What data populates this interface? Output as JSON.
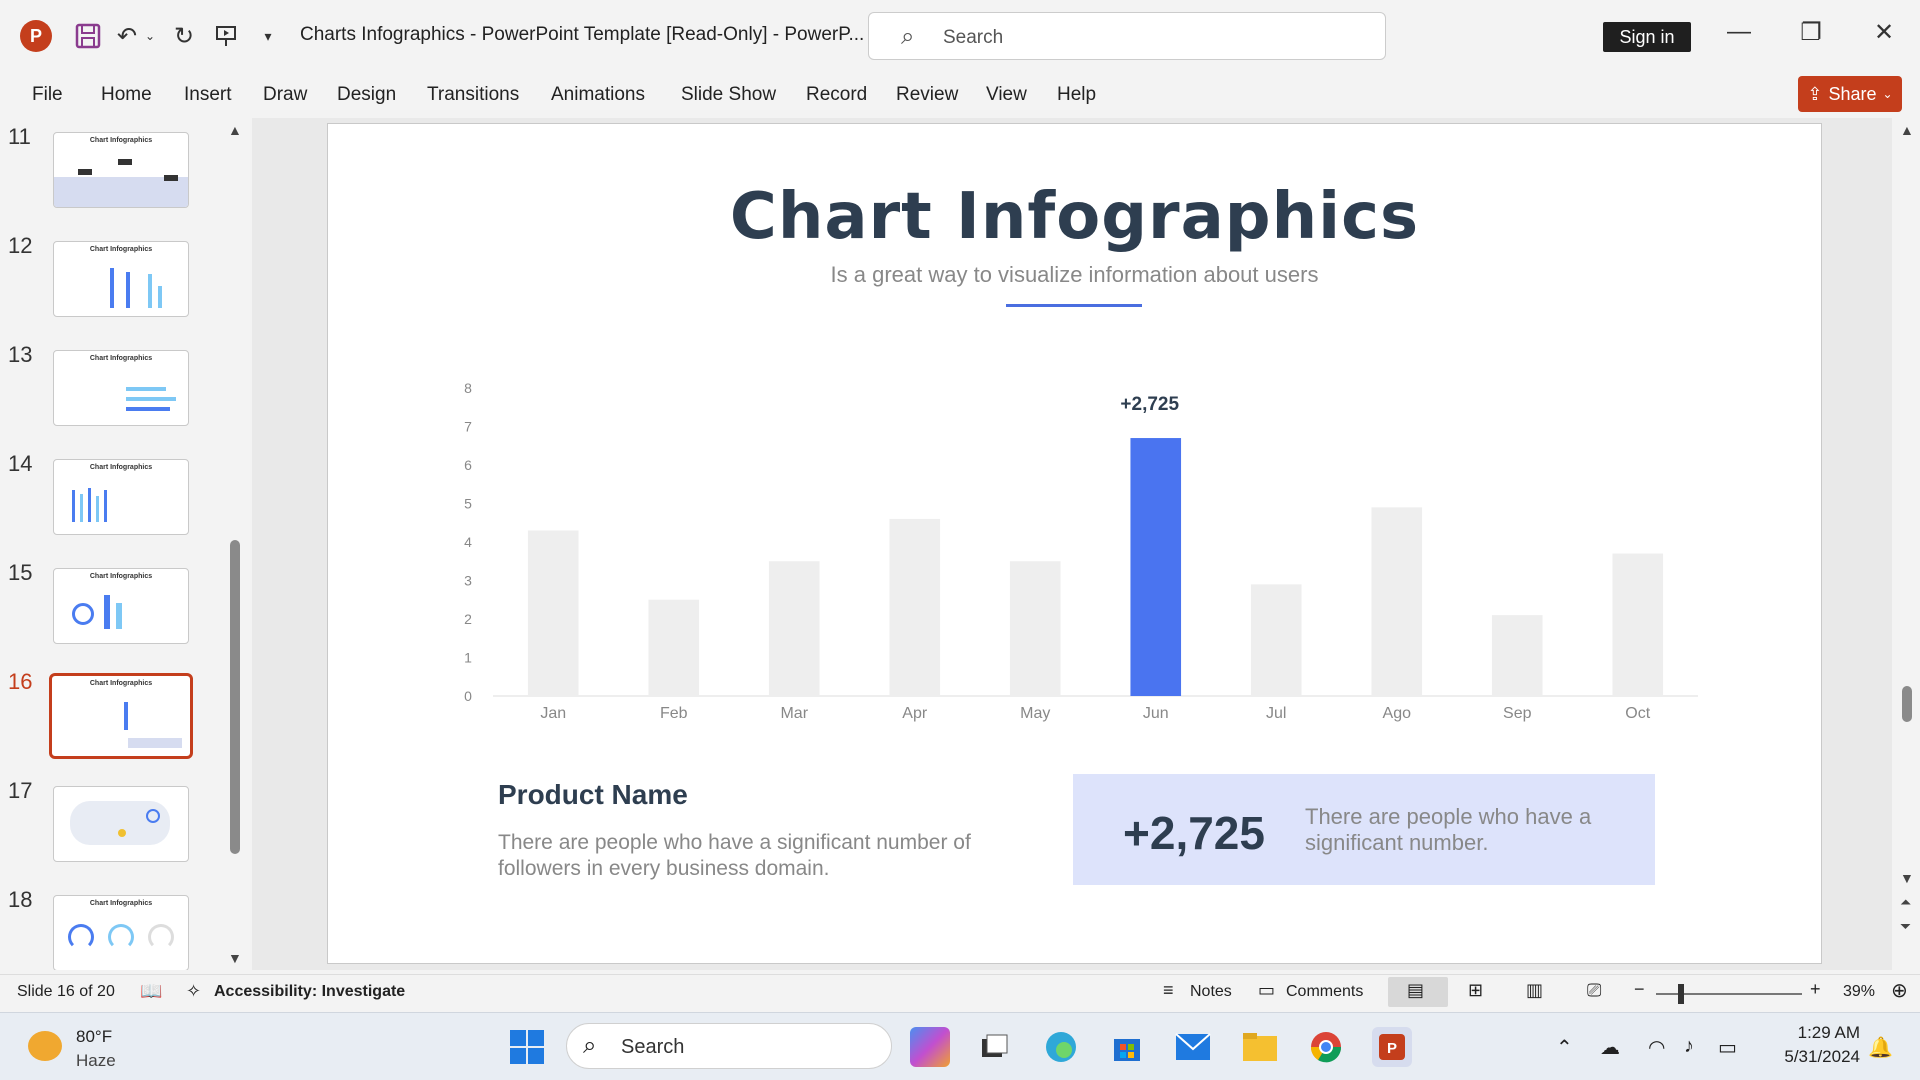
{
  "titlebar": {
    "app_letter": "P",
    "doc_title": "Charts Infographics - PowerPoint Template [Read-Only]  -  PowerP...",
    "search_placeholder": "Search",
    "signin": "Sign in"
  },
  "ribbon": {
    "tabs": [
      "File",
      "Home",
      "Insert",
      "Draw",
      "Design",
      "Transitions",
      "Animations",
      "Slide Show",
      "Record",
      "Review",
      "View",
      "Help"
    ],
    "share": "Share"
  },
  "thumbnails": [
    {
      "num": "11",
      "title": "Chart Infographics"
    },
    {
      "num": "12",
      "title": "Chart Infographics"
    },
    {
      "num": "13",
      "title": "Chart Infographics"
    },
    {
      "num": "14",
      "title": "Chart Infographics"
    },
    {
      "num": "15",
      "title": "Chart Infographics"
    },
    {
      "num": "16",
      "title": "Chart Infographics"
    },
    {
      "num": "17",
      "title": ""
    },
    {
      "num": "18",
      "title": "Chart Infographics"
    }
  ],
  "slide": {
    "title": "Chart Infographics",
    "subtitle": "Is a great way to visualize information about users",
    "product_name": "Product Name",
    "product_desc": "There are people who have a significant number of followers in every business domain.",
    "stat_value": "+2,725",
    "stat_desc": "There are people who have a significant number."
  },
  "chart_data": {
    "type": "bar",
    "categories": [
      "Jan",
      "Feb",
      "Mar",
      "Apr",
      "May",
      "Jun",
      "Jul",
      "Ago",
      "Sep",
      "Oct"
    ],
    "values": [
      4.3,
      2.5,
      3.5,
      4.6,
      3.5,
      6.7,
      2.9,
      4.9,
      2.1,
      3.7
    ],
    "highlight_index": 5,
    "highlight_label": "+2,725",
    "yticks": [
      "0",
      "1",
      "2",
      "3",
      "4",
      "5",
      "6",
      "7",
      "8"
    ],
    "ylim": [
      0,
      8
    ],
    "colors": {
      "bar": "#eeeeee",
      "highlight": "#4a74f0"
    }
  },
  "statusbar": {
    "slide_info": "Slide 16 of 20",
    "accessibility": "Accessibility: Investigate",
    "notes": "Notes",
    "comments": "Comments",
    "zoom": "39%"
  },
  "taskbar": {
    "weather_temp": "80°F",
    "weather_cond": "Haze",
    "search": "Search",
    "time": "1:29 AM",
    "date": "5/31/2024"
  }
}
